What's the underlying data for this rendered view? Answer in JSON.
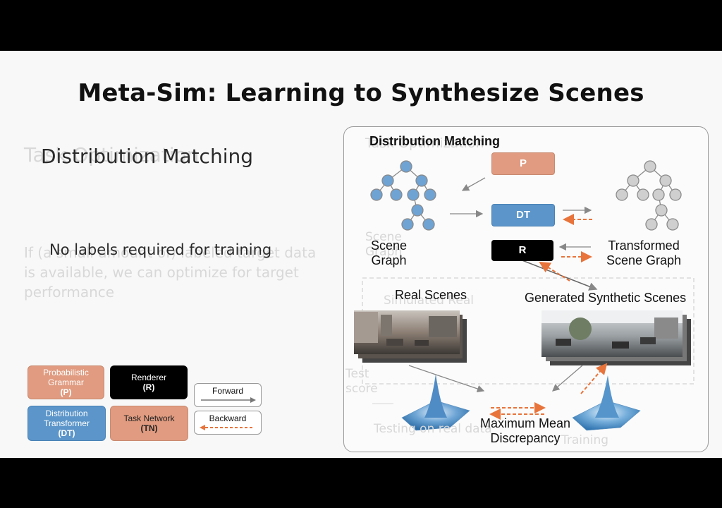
{
  "slide": {
    "title": "Meta-Sim: Learning to Synthesize Scenes",
    "left_heading_ghost": "Task Optimization",
    "left_heading": "Distribution Matching",
    "no_labels": "No labels required for training",
    "ghost_paragraph": [
      "If (a small amount of) labeled target data",
      "is available, we can optimize for target",
      "performance"
    ]
  },
  "legend": {
    "grammar": {
      "label": "Probabilistic Grammar",
      "abbr": "(P)",
      "color": "#e09b80"
    },
    "renderer": {
      "label": "Renderer",
      "abbr": "(R)",
      "color": "#000000"
    },
    "forward": {
      "label": "Forward"
    },
    "transformer": {
      "label": "Distribution Transformer",
      "abbr": "(DT)",
      "color": "#5b95c9"
    },
    "task_network": {
      "label": "Task Network",
      "abbr": "(TN)",
      "color": "#e09b80"
    },
    "backward": {
      "label": "Backward",
      "color": "#e8743b"
    }
  },
  "diagram": {
    "title_ghost": "Task Optimization",
    "title": "Distribution Matching",
    "node_p": "P",
    "node_dt": "DT",
    "node_r": "R",
    "scene_graph": [
      "Scene",
      "Graph"
    ],
    "scene_graph_ghost": [
      "Scene",
      "Graph"
    ],
    "transformed_scene_graph": [
      "Transformed",
      "Scene Graph"
    ],
    "real_scenes": "Real Scenes",
    "real_scenes_ghost": "Simulated Real",
    "generated_scenes": "Generated Synthetic Scenes",
    "test_score_ghost": [
      "Test",
      "score"
    ],
    "testing_ghost": "Testing on real data",
    "training_ghost": "Training",
    "mmd": [
      "Maximum Mean",
      "Discrepancy"
    ]
  }
}
